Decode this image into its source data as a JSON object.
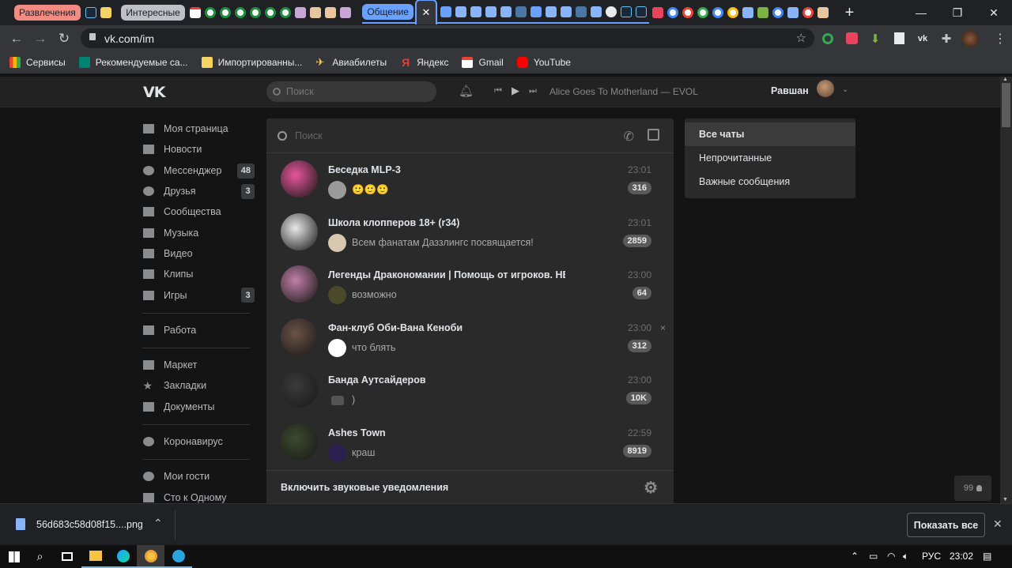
{
  "browser": {
    "tab_groups": [
      {
        "label": "Развлечения",
        "color": "#f28b82"
      },
      {
        "label": "Интересные",
        "color": "#bdc1c6"
      },
      {
        "label": "Общение",
        "color": "#6aa1ff"
      }
    ],
    "active_tab_close": "✕",
    "new_tab": "+",
    "url": "vk.com/im",
    "bookmarks": [
      "Сервисы",
      "Рекомендуемые са...",
      "Импортированны...",
      "Авиабилеты",
      "Яндекс",
      "Gmail",
      "YouTube"
    ]
  },
  "vk": {
    "search_placeholder": "Поиск",
    "player_track": "Alice Goes To Motherland — EVOL",
    "user_name": "Равшан",
    "sidebar": [
      {
        "label": "Моя страница",
        "icon": "home-icon"
      },
      {
        "label": "Новости",
        "icon": "news-icon"
      },
      {
        "label": "Мессенджер",
        "icon": "messenger-icon",
        "count": "48"
      },
      {
        "label": "Друзья",
        "icon": "friends-icon",
        "count": "3"
      },
      {
        "label": "Сообщества",
        "icon": "groups-icon"
      },
      {
        "label": "Музыка",
        "icon": "music-icon"
      },
      {
        "label": "Видео",
        "icon": "video-icon"
      },
      {
        "label": "Клипы",
        "icon": "clips-icon"
      },
      {
        "label": "Игры",
        "icon": "games-icon",
        "count": "3"
      },
      {
        "label": "Работа",
        "icon": "work-icon"
      },
      {
        "label": "Маркет",
        "icon": "market-icon"
      },
      {
        "label": "Закладки",
        "icon": "star-icon"
      },
      {
        "label": "Документы",
        "icon": "document-icon"
      },
      {
        "label": "Коронавирус",
        "icon": "virus-icon"
      },
      {
        "label": "Мои гости",
        "icon": "guests-icon"
      },
      {
        "label": "Сто к Одному",
        "icon": "game-app-icon"
      }
    ],
    "messages": {
      "search_placeholder": "Поиск",
      "chats": [
        {
          "name": "Беседка MLP-3",
          "time": "23:01",
          "unread": "316",
          "preview": "🙂🙂🙂",
          "avatar": "#e8559b"
        },
        {
          "name": "Школа клопперов 18+ (r34)",
          "time": "23:01",
          "unread": "2859",
          "preview": "Всем фанатам Даззлингс посвящается!",
          "avatar": "#e9e9e9"
        },
        {
          "name": "Легенды Дракономании | Помощь от игроков. НЕ...",
          "time": "23:00",
          "unread": "64",
          "preview": "возможно",
          "avatar": "#c27fa8"
        },
        {
          "name": "Фан-клуб Оби-Вана Кеноби",
          "time": "23:00",
          "unread": "312",
          "preview": "что блять",
          "avatar": "#6b5245",
          "close": "×"
        },
        {
          "name": "Банда Аутсайдеров",
          "time": "23:00",
          "unread": "10K",
          "preview": ")",
          "avatar": "#3b3b3b"
        },
        {
          "name": "Ashes Town",
          "time": "22:59",
          "unread": "8919",
          "preview": "краш",
          "avatar": "#3c4a2e"
        }
      ],
      "footer_label": "Включить звуковые уведомления"
    },
    "filters": [
      "Все чаты",
      "Непрочитанные",
      "Важные сообщения"
    ],
    "online_count": "99"
  },
  "download": {
    "filename": "56d683c58d08f15....png",
    "show_all": "Показать все"
  },
  "taskbar": {
    "lang": "РУС",
    "time": "23:02"
  }
}
